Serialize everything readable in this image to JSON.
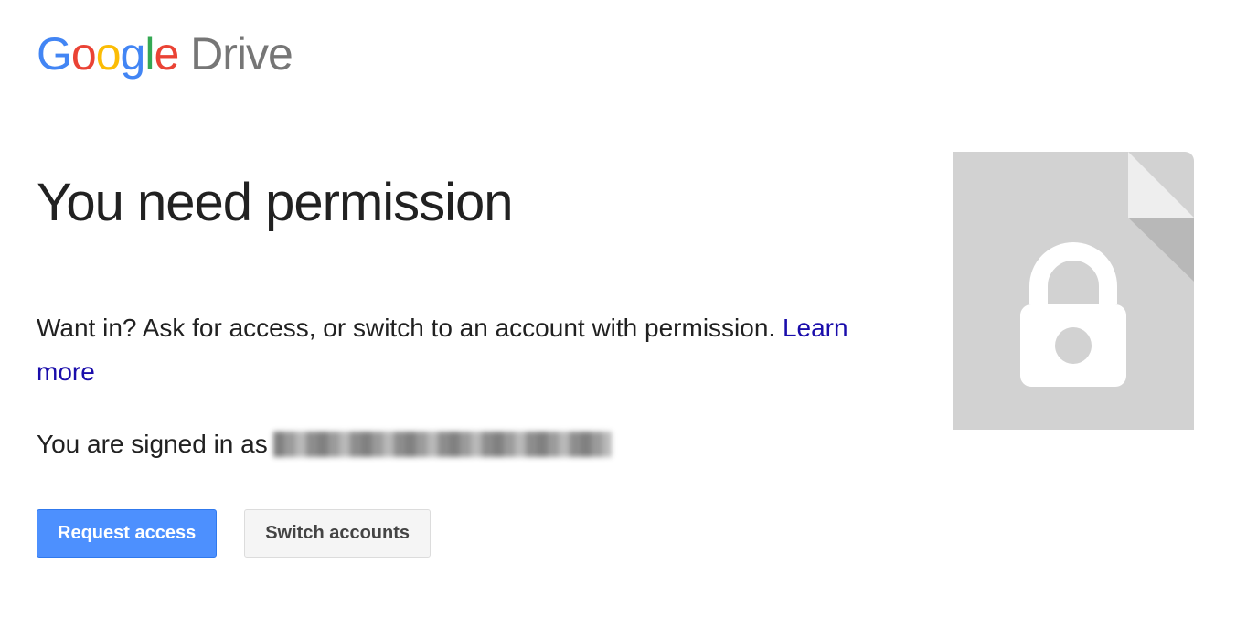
{
  "logo": {
    "google": "Google",
    "drive": "Drive"
  },
  "heading": "You need permission",
  "subtext": "Want in? Ask for access, or switch to an account with permission. ",
  "learn_more": "Learn more",
  "signed_in_prefix": "You are signed in as ",
  "buttons": {
    "request_access": "Request access",
    "switch_accounts": "Switch accounts"
  }
}
